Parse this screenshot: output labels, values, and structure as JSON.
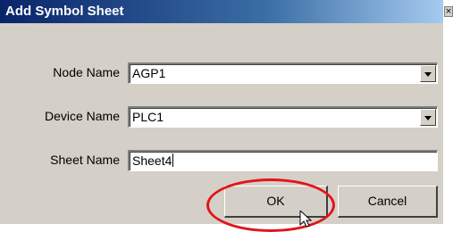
{
  "dialog": {
    "title": "Add Symbol Sheet",
    "close_glyph": "×"
  },
  "fields": {
    "node_name": {
      "label": "Node Name",
      "value": "AGP1"
    },
    "device_name": {
      "label": "Device Name",
      "value": "PLC1"
    },
    "sheet_name": {
      "label": "Sheet Name",
      "value": "Sheet4"
    }
  },
  "buttons": {
    "ok": "OK",
    "cancel": "Cancel"
  },
  "colors": {
    "highlight_ring": "#e3141b",
    "titlebar_start": "#0a246a",
    "face": "#d4d0c8"
  },
  "icons": {
    "pointer": "arrow-pointer-icon",
    "dropdown": "chevron-down-icon"
  }
}
